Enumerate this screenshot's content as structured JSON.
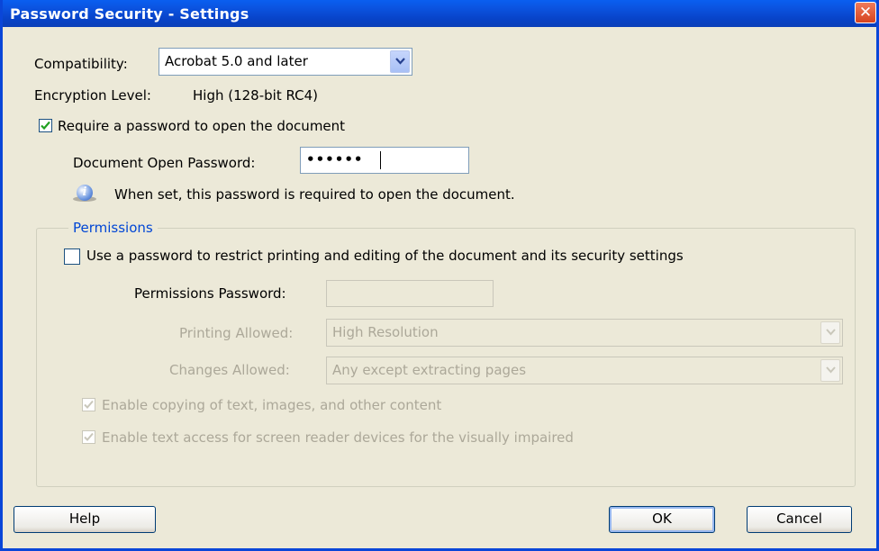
{
  "window": {
    "title": "Password Security - Settings",
    "close_glyph": "✕"
  },
  "compatibility": {
    "label": "Compatibility:",
    "value": "Acrobat 5.0 and later"
  },
  "encryption": {
    "label": "Encryption Level:",
    "value": "High (128-bit RC4)"
  },
  "require_open_password": {
    "label": "Require a password to open the document",
    "checked": true
  },
  "open_password": {
    "label": "Document Open Password:",
    "masked_value": "••••••"
  },
  "info": {
    "icon": "info-icon",
    "text": "When set, this password is required to open the document."
  },
  "permissions": {
    "legend": "Permissions",
    "use_password": {
      "label": "Use a password to restrict printing and editing of the document and its security settings",
      "checked": false
    },
    "password_label": "Permissions Password:",
    "printing": {
      "label": "Printing Allowed:",
      "value": "High Resolution"
    },
    "changes": {
      "label": "Changes Allowed:",
      "value": "Any except extracting pages"
    },
    "enable_copying": {
      "label": "Enable copying of text, images, and other content",
      "checked": true
    },
    "enable_screen_reader": {
      "label": "Enable text access for screen reader devices for the visually impaired",
      "checked": true
    }
  },
  "buttons": {
    "help": "Help",
    "ok": "OK",
    "cancel": "Cancel"
  },
  "colors": {
    "titlebar": "#0a46d8",
    "dialog_bg": "#ece9d8",
    "legend": "#0046d5",
    "disabled_text": "#aca899"
  }
}
